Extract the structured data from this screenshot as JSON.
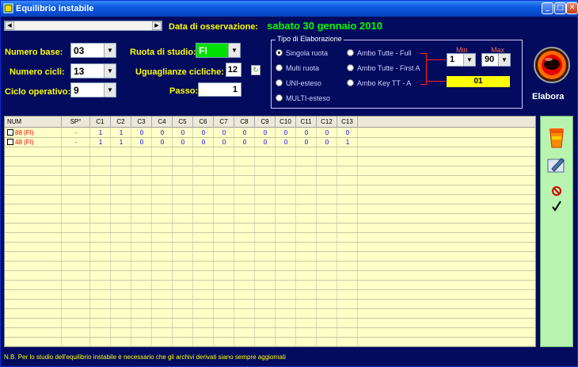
{
  "window": {
    "title": "Equilibrio instabile",
    "controls": [
      "minimize",
      "maximize",
      "close"
    ]
  },
  "observation": {
    "label": "Data di osservazione:",
    "date": "sabato 30 gennaio 2010"
  },
  "params": {
    "numero_base": {
      "label": "Numero base:",
      "value": "03"
    },
    "numero_cicli": {
      "label": "Numero cicli:",
      "value": "13"
    },
    "ciclo_operativo": {
      "label": "Ciclo operativo:",
      "value": "9"
    },
    "ruota": {
      "label": "Ruota di studio:",
      "value": "FI"
    },
    "uguaglianze": {
      "label": "Uguaglianze cicliche:",
      "value": "12"
    },
    "passo": {
      "label": "Passo:",
      "value": "1"
    }
  },
  "elaborazione": {
    "title": "Tipo di Elaborazione",
    "options": [
      {
        "label": "Singola ruota",
        "selected": true
      },
      {
        "label": "Multi ruota",
        "selected": false
      },
      {
        "label": "UNI-esteso",
        "selected": false
      },
      {
        "label": "MULTI-esteso",
        "selected": false
      },
      {
        "label": "Ambo Tutte - Full",
        "selected": false
      },
      {
        "label": "Ambo Tutte - First A",
        "selected": false
      },
      {
        "label": "Ambo Key TT -  A",
        "selected": false
      }
    ],
    "min_label": "Min",
    "max_label": "Max",
    "min_value": "1",
    "max_value": "90",
    "result": "01"
  },
  "elabora_label": "Elabora",
  "grid": {
    "headers": [
      "NUM",
      "SP°",
      "C1",
      "C2",
      "C3",
      "C4",
      "C5",
      "C6",
      "C7",
      "C8",
      "C9",
      "C10",
      "C11",
      "C12",
      "C13"
    ],
    "rows": [
      {
        "num": "88  (FI)",
        "sp": "-",
        "cells": [
          "1",
          "1",
          "0",
          "0",
          "0",
          "0",
          "0",
          "0",
          "0",
          "0",
          "0",
          "0",
          "0"
        ]
      },
      {
        "num": "48  (FI)",
        "sp": "-",
        "cells": [
          "1",
          "1",
          "0",
          "0",
          "0",
          "0",
          "0",
          "0",
          "0",
          "0",
          "0",
          "0",
          "1"
        ]
      }
    ]
  },
  "side_tools": [
    "trash-icon",
    "edit-icon",
    "stop-icon",
    "check-icon"
  ],
  "colors": {
    "window_bg": "#020b5e",
    "label": "#ffff00",
    "date": "#00ff00",
    "grid_bg": "#ffffc8"
  },
  "footer_note": "N.B. Per lo studio dell'equilibrio instabile è necessario che gli archivi derivati siano sempre aggiornati"
}
